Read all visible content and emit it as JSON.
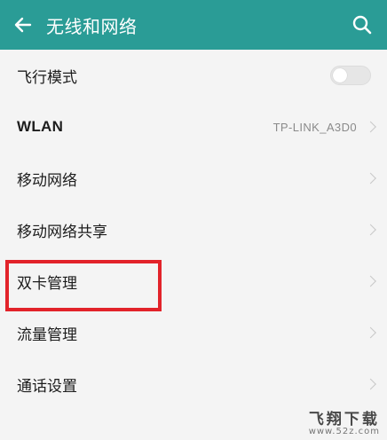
{
  "header": {
    "title": "无线和网络",
    "color": "#2a9c96"
  },
  "icons": {
    "back": "arrow-left-icon",
    "search": "search-icon",
    "chevron": "chevron-right-icon"
  },
  "rows": [
    {
      "label": "飞行模式",
      "control": "toggle",
      "toggle_on": false
    },
    {
      "label": "WLAN",
      "value": "TP-LINK_A3D0"
    },
    {
      "label": "移动网络"
    },
    {
      "label": "移动网络共享"
    },
    {
      "label": "双卡管理",
      "highlighted": true
    },
    {
      "label": "流量管理"
    },
    {
      "label": "通话设置"
    }
  ],
  "highlight_color": "#e2232a",
  "watermark": {
    "main": "飞翔下载",
    "sub": "www.52z.com"
  }
}
